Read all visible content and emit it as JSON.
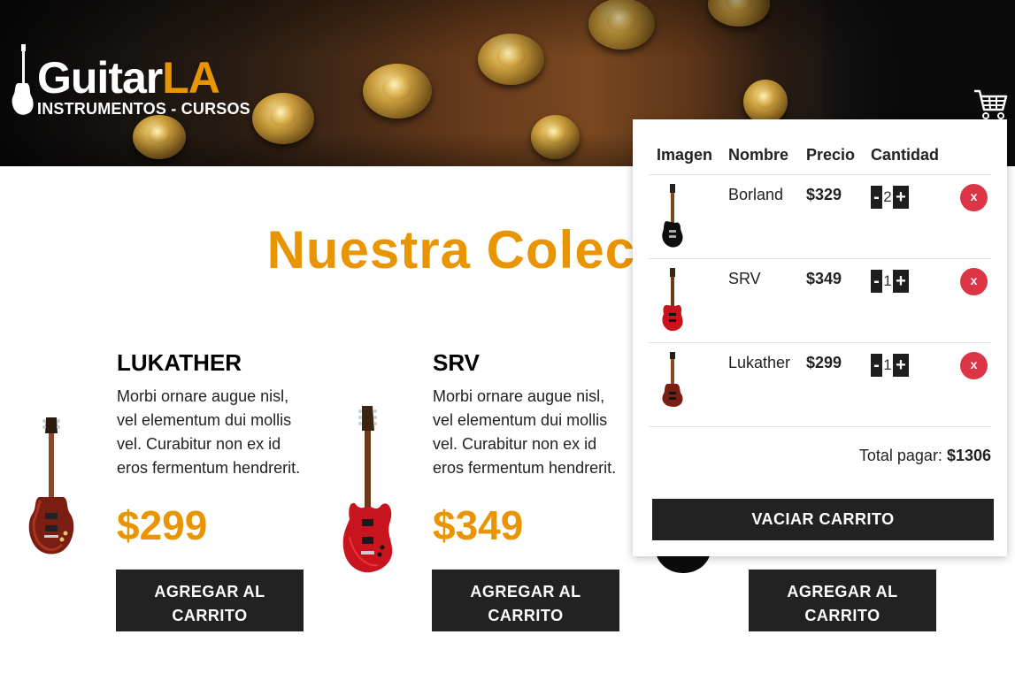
{
  "brand": {
    "name_main": "Guitar",
    "name_accent": "LA",
    "tagline": "INSTRUMENTOS - CURSOS",
    "accent_color": "#e99401"
  },
  "header": {
    "cart_icon": "shopping-cart-icon"
  },
  "main": {
    "heading": "Nuestra Colección"
  },
  "products": [
    {
      "name": "LUKATHER",
      "description": "Morbi ornare augue nisl, vel elementum dui mollis vel. Curabitur non ex id eros fermentum hendrerit.",
      "price": "$299",
      "button_label": "AGREGAR AL CARRITO"
    },
    {
      "name": "SRV",
      "description": "Morbi ornare augue nisl, vel elementum dui mollis vel. Curabitur non ex id eros fermentum hendrerit.",
      "price": "$349",
      "button_label": "AGREGAR AL CARRITO"
    },
    {
      "name": "",
      "description": "",
      "price": "",
      "button_label": "AGREGAR AL CARRITO"
    }
  ],
  "cart": {
    "columns": [
      "Imagen",
      "Nombre",
      "Precio",
      "Cantidad"
    ],
    "items": [
      {
        "name": "Borland",
        "price": "$329",
        "quantity": "2",
        "minus": "-",
        "plus": "+",
        "remove": "x"
      },
      {
        "name": "SRV",
        "price": "$349",
        "quantity": "1",
        "minus": "-",
        "plus": "+",
        "remove": "x"
      },
      {
        "name": "Lukather",
        "price": "$299",
        "quantity": "1",
        "minus": "-",
        "plus": "+",
        "remove": "x"
      }
    ],
    "total_label": "Total pagar: ",
    "total_value": "$1306",
    "empty_button": "VACIAR CARRITO"
  },
  "colors": {
    "accent": "#e99401",
    "dark": "#222222",
    "danger": "#dc3545"
  }
}
